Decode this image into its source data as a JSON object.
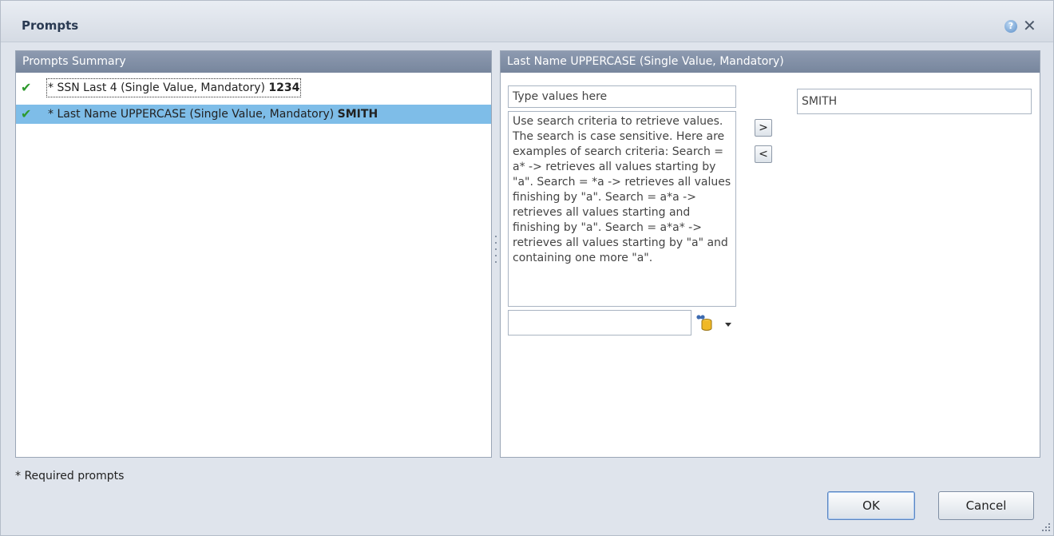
{
  "dialog": {
    "title": "Prompts",
    "help_icon": "help-icon",
    "close_icon": "close-icon"
  },
  "left_panel": {
    "header": "Prompts Summary",
    "rows": [
      {
        "icon": "checkmark-icon",
        "label": "* SSN Last 4 (Single Value, Mandatory)",
        "value": "1234",
        "selected": false,
        "focused": true
      },
      {
        "icon": "checkmark-icon",
        "label": "* Last Name UPPERCASE (Single Value, Mandatory)",
        "value": "SMITH",
        "selected": true,
        "focused": false
      }
    ]
  },
  "right_panel": {
    "header": "Last Name UPPERCASE (Single Value, Mandatory)",
    "type_input_placeholder": "Type values here",
    "hint_text": "Use search criteria to retrieve values. The search is case sensitive. Here are examples of search criteria: Search = a* -> retrieves all values starting by \"a\". Search = *a -> retrieves all values finishing by \"a\". Search = a*a -> retrieves all values starting and finishing by \"a\". Search = a*a* -> retrieves all values starting by \"a\" and containing one more \"a\".",
    "search_input_value": "",
    "add_button": ">",
    "remove_button": "<",
    "selected_value": "SMITH",
    "search_icon": "database-search-icon"
  },
  "footer": {
    "required_note": "* Required prompts",
    "ok_label": "OK",
    "cancel_label": "Cancel"
  },
  "colors": {
    "header_bg": "#8591a6",
    "selected_row": "#7ebde8",
    "check": "#2e9a2e"
  }
}
